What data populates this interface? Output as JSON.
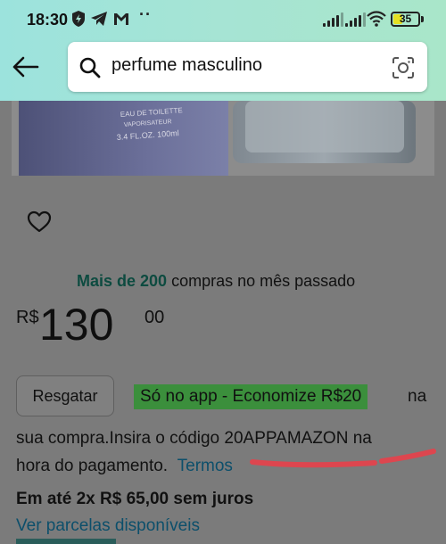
{
  "status_bar": {
    "time": "18:30",
    "more": "··",
    "battery": "35",
    "battery_level": 0.35,
    "icons": [
      "shield-icon",
      "telegram-icon",
      "gmail-icon",
      "signal-icon",
      "signal-icon",
      "wifi-icon",
      "battery-icon"
    ]
  },
  "search": {
    "query": "perfume masculino"
  },
  "product": {
    "image_text": [
      "EAU DE TOILETTE",
      "VAPORISATEUR",
      "3.4 FL.OZ. 100ml"
    ],
    "purchases_highlight": "Mais de 200",
    "purchases_rest": " compras no mês passado",
    "price": {
      "currency": "R$",
      "integer": "130",
      "decimal": "00"
    }
  },
  "promo": {
    "redeem_label": "Resgatar",
    "badge": "Só no app - Economize R$20",
    "na": "na",
    "line2": "sua compra.Insira o código 20APPAMAZON na",
    "line3": "hora do pagamento.",
    "terms": "Termos"
  },
  "installments": {
    "text": "Em até 2x R$ 65,00 sem juros",
    "link": "Ver parcelas disponíveis"
  },
  "colors": {
    "header_accent": "#a6e4d4",
    "promo_badge": "#3b8f3c",
    "link": "#0c4f6b",
    "highlight_text": "#0d4b40",
    "annotation": "#e8404a"
  }
}
